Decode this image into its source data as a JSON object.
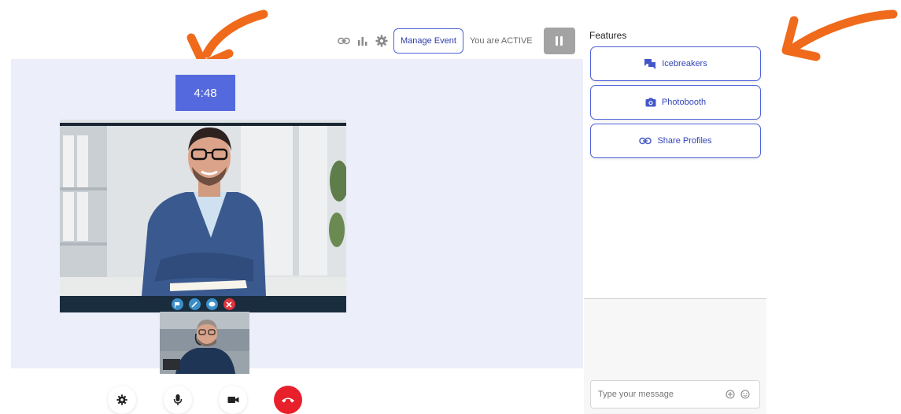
{
  "toolbar": {
    "manage_event_label": "Manage Event",
    "status_text": "You are ACTIVE",
    "icons": [
      "link-icon",
      "bar-chart-icon",
      "gear-icon",
      "pause-icon"
    ]
  },
  "stage": {
    "timer": "4:48",
    "video_controls": [
      "flag-icon",
      "pen-icon",
      "chat-icon",
      "close-icon"
    ]
  },
  "call_controls": [
    "gear-icon",
    "microphone-icon",
    "camera-icon",
    "end-call-icon"
  ],
  "sidebar": {
    "title": "Features",
    "items": [
      {
        "label": "Icebreakers",
        "icon": "chat-bubbles-icon"
      },
      {
        "label": "Photobooth",
        "icon": "camera-icon"
      },
      {
        "label": "Share Profiles",
        "icon": "link-icon"
      }
    ]
  },
  "chat": {
    "placeholder": "Type your message",
    "icons": [
      "add-icon",
      "emoji-icon"
    ]
  },
  "colors": {
    "accent": "#5469de",
    "annotation_arrow": "#f06a1c",
    "end_call": "#e8202b",
    "stage_bg": "#eceef9"
  }
}
